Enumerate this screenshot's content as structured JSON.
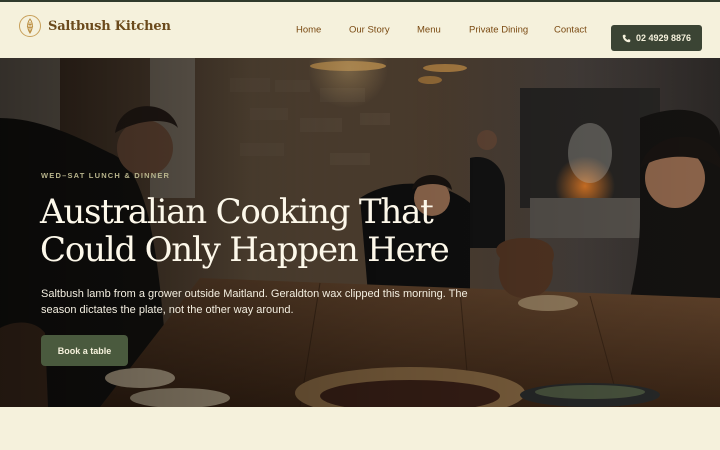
{
  "brand": {
    "name": "Saltbush Kitchen",
    "logo_icon": "saltbush-leaf-icon",
    "color": "#6b4a1c"
  },
  "nav": {
    "items": [
      {
        "label": "Home"
      },
      {
        "label": "Our Story"
      },
      {
        "label": "Menu"
      },
      {
        "label": "Private Dining"
      },
      {
        "label": "Contact"
      }
    ]
  },
  "header": {
    "phone_label": "02 4929 8876",
    "phone_icon": "phone-icon"
  },
  "hero": {
    "eyebrow": "WED–SAT LUNCH & DINNER",
    "title": "Australian Cooking That Could Only Happen Here",
    "subtitle": "Saltbush lamb from a grower outside Maitland. Geraldton wax clipped this morning. The season dictates the plate, not the other way around.",
    "cta_label": "Book a table"
  },
  "colors": {
    "background": "#f5f1dc",
    "accent_dark": "#3b4434",
    "cta": "#4a5a3e",
    "nav_text": "#7a4a12"
  }
}
